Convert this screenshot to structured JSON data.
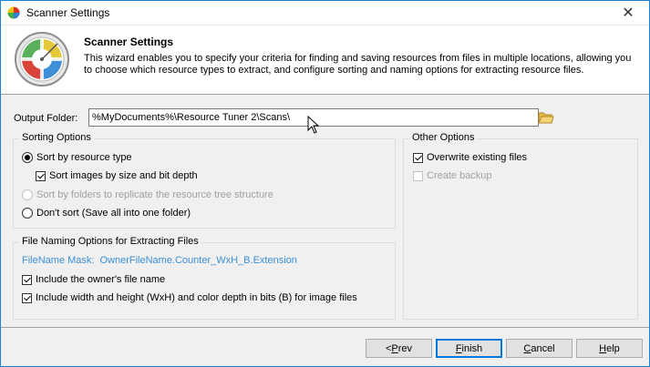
{
  "window": {
    "title": "Scanner Settings",
    "close_symbol": "✕"
  },
  "header": {
    "title": "Scanner Settings",
    "description": "This wizard enables you to specify your criteria for finding and saving resources from files in multiple locations, allowing you to choose which resource types to extract, and configure sorting and naming options for extracting resource files."
  },
  "output": {
    "label": "Output Folder:",
    "value": "%MyDocuments%\\Resource Tuner 2\\Scans\\"
  },
  "sorting": {
    "title": "Sorting Options",
    "options": [
      {
        "label": "Sort by resource type",
        "checked": true,
        "enabled": true
      },
      {
        "label": "Sort images by size and bit depth",
        "checked": true,
        "enabled": true
      },
      {
        "label": "Sort by folders to replicate the resource tree structure",
        "checked": false,
        "enabled": false
      },
      {
        "label": "Don't sort (Save all into one folder)",
        "checked": false,
        "enabled": true
      }
    ]
  },
  "naming": {
    "title": "File Naming Options for Extracting Files",
    "mask_label": "FileName Mask:",
    "mask_value": "OwnerFileName.Counter_WxH_B.Extension",
    "options": [
      {
        "label": "Include the owner's file name",
        "checked": true
      },
      {
        "label": "Include width and height (WxH) and color depth in bits (B) for image files",
        "checked": true
      }
    ]
  },
  "other": {
    "title": "Other Options",
    "options": [
      {
        "label": "Overwrite existing files",
        "checked": true,
        "enabled": true
      },
      {
        "label": "Create backup",
        "checked": false,
        "enabled": false
      }
    ]
  },
  "buttons": {
    "prev_prefix": "< ",
    "prev_key": "P",
    "prev_rest": "rev",
    "finish_key": "F",
    "finish_rest": "inish",
    "cancel_key": "C",
    "cancel_rest": "ancel",
    "help_key": "H",
    "help_rest": "elp"
  },
  "colors": {
    "accent": "#0078d7",
    "link": "#3c8fd6",
    "window_border": "#1883d7"
  }
}
